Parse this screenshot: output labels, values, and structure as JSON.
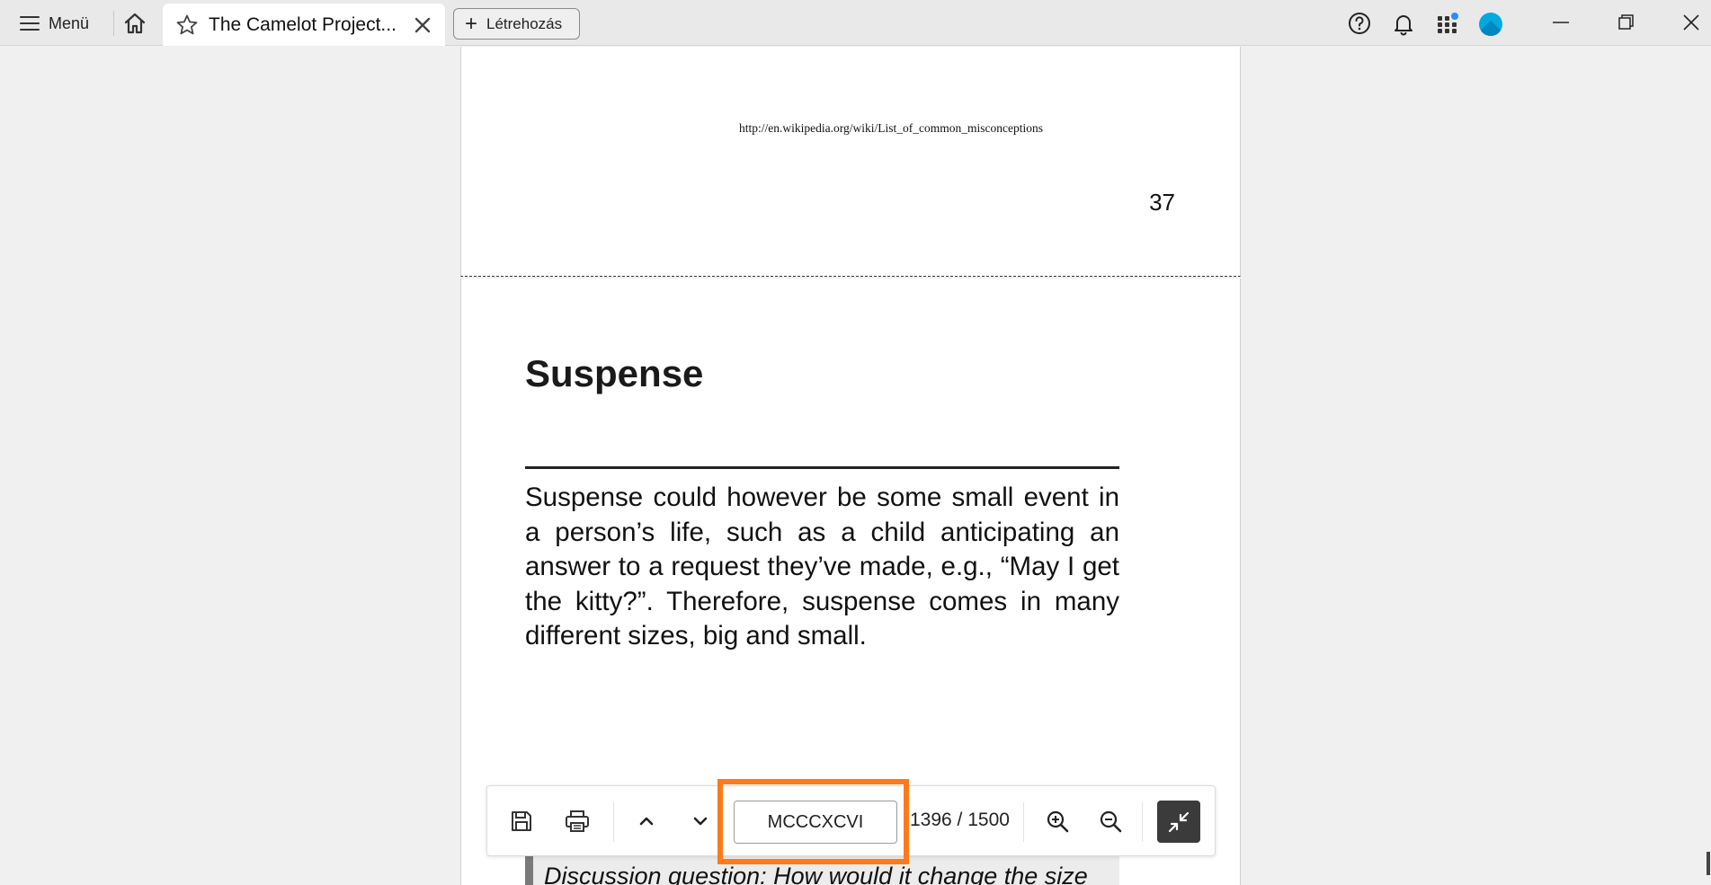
{
  "topbar": {
    "menu_label": "Menü",
    "tab_title": "The Camelot Project...",
    "create_label": "Létrehozás"
  },
  "document": {
    "url": "http://en.wikipedia.org/wiki/List_of_common_misconceptions",
    "page_number": "37",
    "heading": "Suspense",
    "body": "Suspense could however be some small event in a person’s life, such as a child anticipating an answer to a request they’ve made, e.g., “May I get the kitty?”. Therefore, suspense comes in many different sizes, big and small.",
    "discussion": "Discussion question: How would it change the size"
  },
  "toolbar": {
    "page_input_value": "MCCCXCVI",
    "page_count": "1396 / 1500"
  },
  "colors": {
    "highlight": "#ff7a1a",
    "avatar": "#00a9e0",
    "notification_dot": "#2a8cff"
  }
}
